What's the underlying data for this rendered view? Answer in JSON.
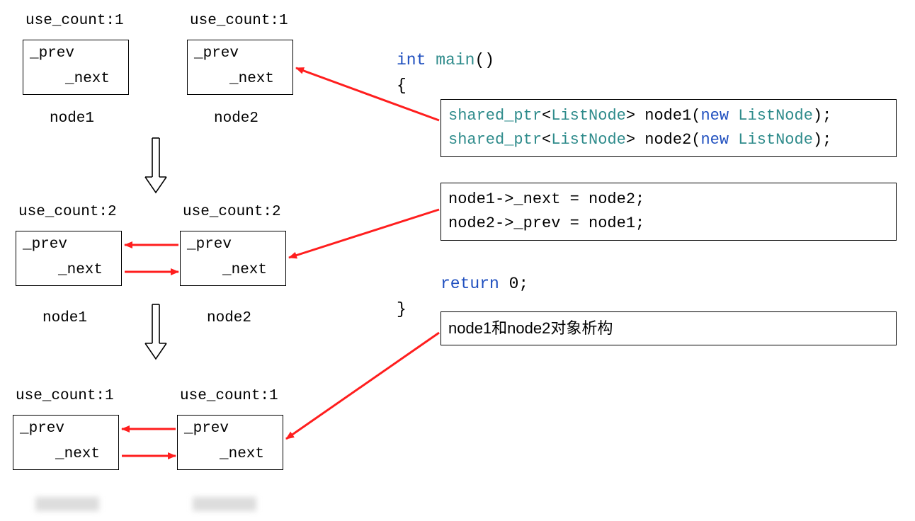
{
  "stages": [
    {
      "use_count_left": "use_count:1",
      "use_count_right": "use_count:1",
      "node_left_label": "node1",
      "node_right_label": "node2"
    },
    {
      "use_count_left": "use_count:2",
      "use_count_right": "use_count:2",
      "node_left_label": "node1",
      "node_right_label": "node2"
    },
    {
      "use_count_left": "use_count:1",
      "use_count_right": "use_count:1",
      "node_left_label": "",
      "node_right_label": ""
    }
  ],
  "node_fields": {
    "prev": "_prev",
    "next": "_next"
  },
  "code": {
    "sig_type": "int",
    "sig_name": "main",
    "sig_parens": "()",
    "brace_open": "{",
    "line1": {
      "sp": "shared_ptr",
      "lt": "<",
      "ln": "ListNode",
      "gt": ">",
      "var": " node1",
      "op": "(",
      "nw": "new",
      "ln2": " ListNode",
      "cl": ");"
    },
    "line2": {
      "sp": "shared_ptr",
      "lt": "<",
      "ln": "ListNode",
      "gt": ">",
      "var": " node2",
      "op": "(",
      "nw": "new",
      "ln2": " ListNode",
      "cl": ");"
    },
    "box2_line1": "node1->_next = node2;",
    "box2_line2": "node2->_prev = node1;",
    "return_kw": "return",
    "return_rest": " 0;",
    "brace_close": "}",
    "box3_text": "node1和node2对象析构"
  }
}
